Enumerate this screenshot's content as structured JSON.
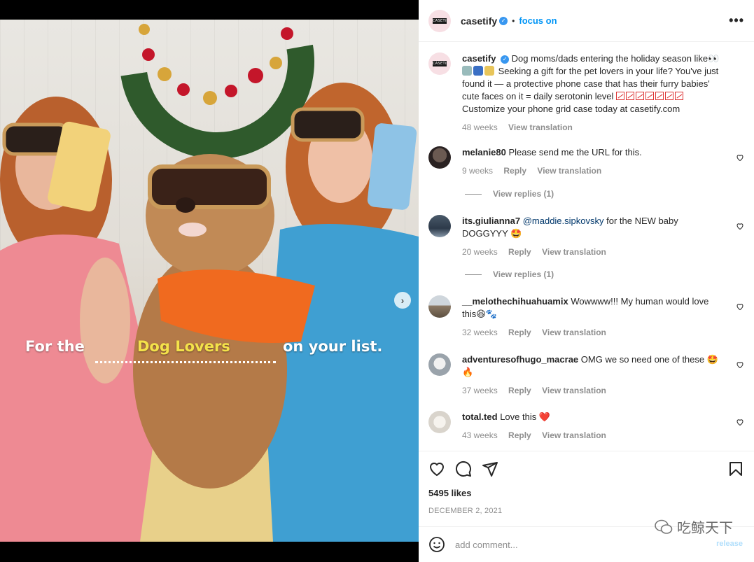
{
  "post": {
    "slide_text": {
      "part1": "For the",
      "part2": "Dog Lovers",
      "part3": "on your list."
    }
  },
  "header": {
    "username": "casetify",
    "avatar_logo": "CASETiFY",
    "separator": "•",
    "follow_label": "focus on",
    "more_label": "•••"
  },
  "caption": {
    "username": "casetify",
    "text_1": "Dog moms/dads entering the holiday season like👀",
    "text_2": "Seeking a gift for the pet lovers in your life? You've just found it — a protective phone case that has their furry babies' cute faces on it = daily serotonin level",
    "text_3": "Customize your phone grid case today at casetify.com",
    "time": "48 weeks",
    "translate": "View translation"
  },
  "comments": [
    {
      "username": "melanie80",
      "text": "Please send me the URL for this.",
      "time": "9 weeks",
      "reply": "Reply",
      "translate": "View translation",
      "replies": "View replies (1)"
    },
    {
      "username": "its.giulianna7",
      "mention": "@maddie.sipkovsky",
      "text": "for the NEW baby DOGGYYY 🤩",
      "time": "20 weeks",
      "reply": "Reply",
      "translate": "View translation",
      "replies": "View replies (1)"
    },
    {
      "username": "__melothechihuahuamix",
      "text": "Wowwww!!! My human would love this😆🐾",
      "time": "32 weeks",
      "reply": "Reply",
      "translate": "View translation"
    },
    {
      "username": "adventuresofhugo_macrae",
      "text": "OMG we so need one of these 🤩🔥",
      "time": "37 weeks",
      "reply": "Reply",
      "translate": "View translation"
    },
    {
      "username": "total.ted",
      "text": "Love this ❤️",
      "time": "43 weeks",
      "reply": "Reply",
      "translate": "View translation"
    }
  ],
  "actions": {
    "likes": "5495 likes",
    "date": "DECEMBER 2, 2021"
  },
  "comment_box": {
    "placeholder": "add comment...",
    "submit_label": "release"
  },
  "watermark": "吃鲸天下",
  "colors": {
    "accent": "#0095f6",
    "verified": "#3897f0",
    "muted": "#8e8e8e",
    "heart_red": "#e0245e"
  }
}
